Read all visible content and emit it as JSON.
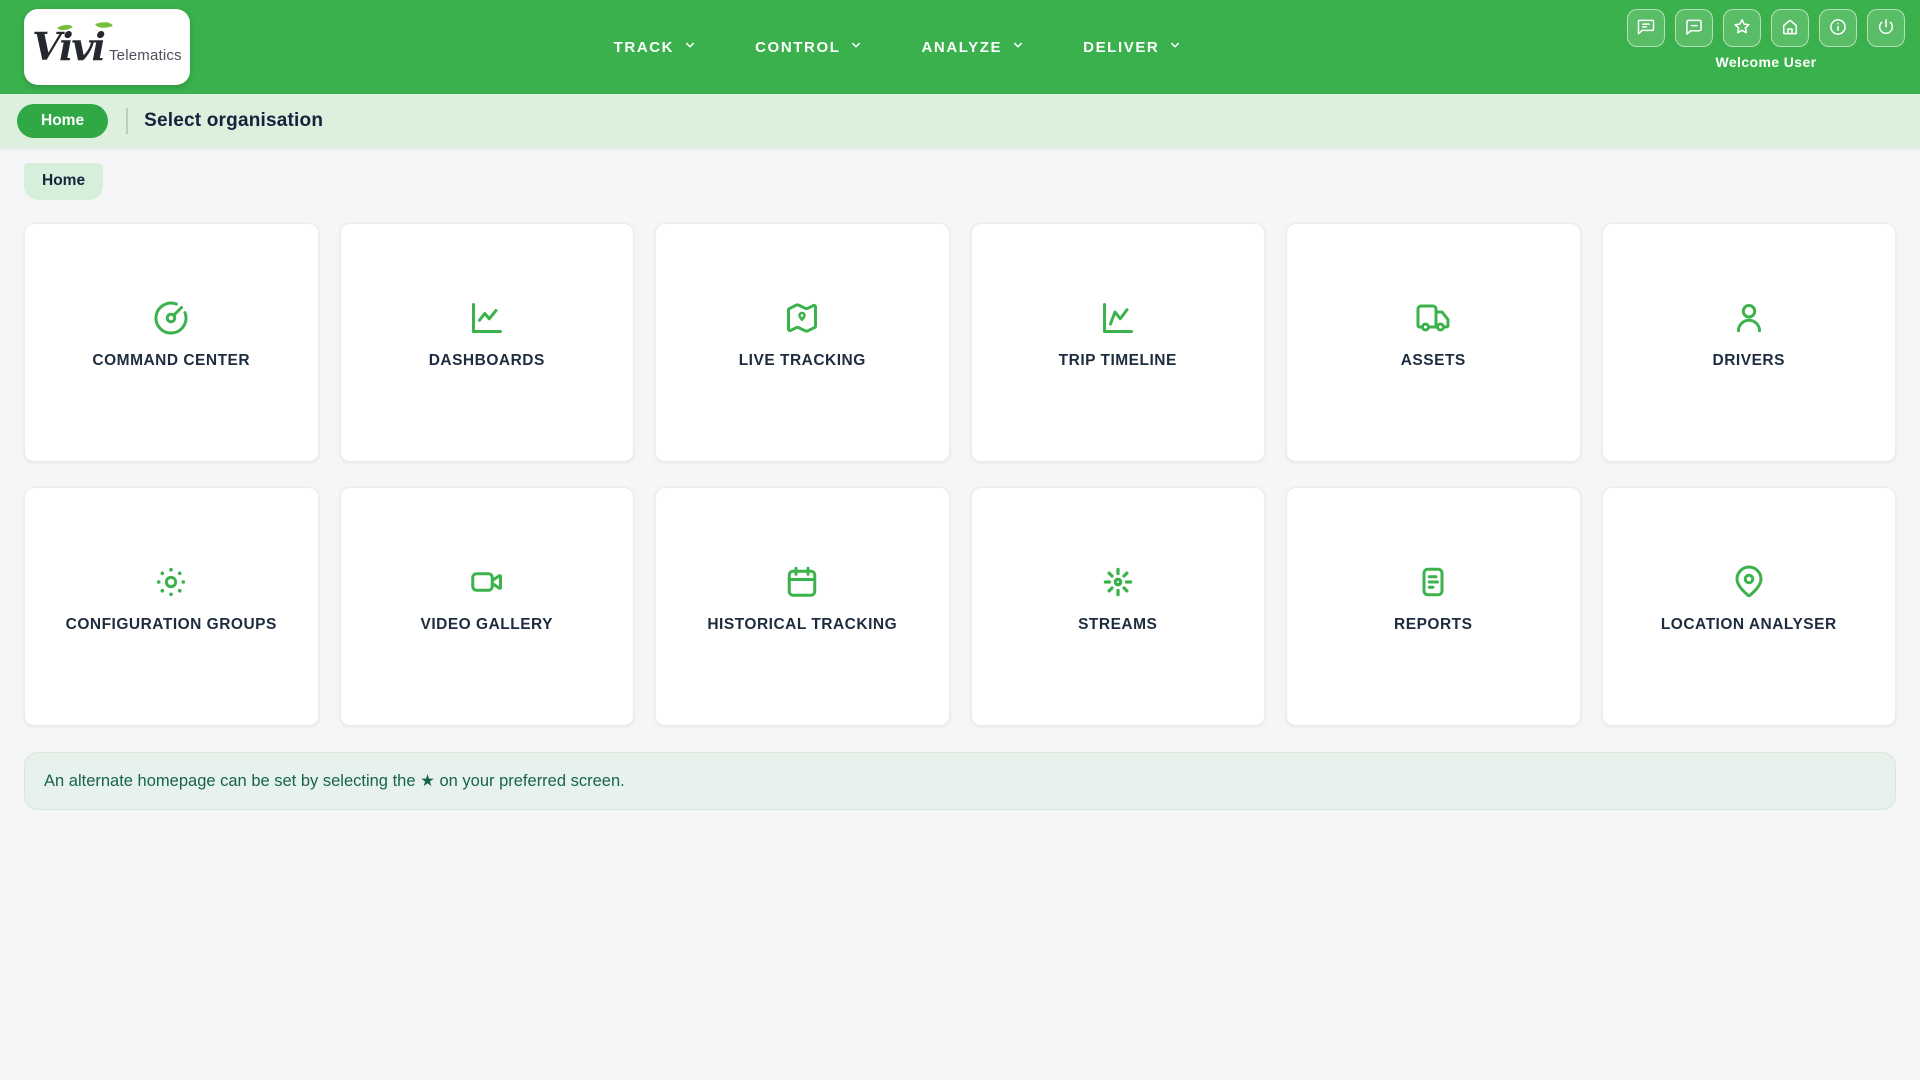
{
  "header": {
    "logo": {
      "brand": "Vivi",
      "suffix": "Telematics"
    },
    "nav_items": [
      {
        "label": "TRACK"
      },
      {
        "label": "CONTROL"
      },
      {
        "label": "ANALYZE"
      },
      {
        "label": "DELIVER"
      }
    ],
    "icon_buttons": [
      {
        "name": "feedback-icon"
      },
      {
        "name": "chat-icon"
      },
      {
        "name": "star-icon"
      },
      {
        "name": "home-icon"
      },
      {
        "name": "info-icon"
      },
      {
        "name": "power-icon"
      }
    ],
    "welcome_text": "Welcome User"
  },
  "subheader": {
    "active_page": "Home",
    "title": "Select organisation"
  },
  "tabs": [
    {
      "label": "Home"
    }
  ],
  "cards": [
    {
      "label": "COMMAND CENTER",
      "icon": "gauge-icon"
    },
    {
      "label": "DASHBOARDS",
      "icon": "line-chart-icon"
    },
    {
      "label": "LIVE TRACKING",
      "icon": "map-with-pin-icon"
    },
    {
      "label": "TRIP TIMELINE",
      "icon": "trend-chart-icon"
    },
    {
      "label": "ASSETS",
      "icon": "truck-icon"
    },
    {
      "label": "DRIVERS",
      "icon": "user-icon"
    },
    {
      "label": "CONFIGURATION GROUPS",
      "icon": "dotted-ring-icon"
    },
    {
      "label": "VIDEO GALLERY",
      "icon": "video-camera-icon"
    },
    {
      "label": "HISTORICAL TRACKING",
      "icon": "calendar-icon"
    },
    {
      "label": "STREAMS",
      "icon": "radiating-dot-icon"
    },
    {
      "label": "REPORTS",
      "icon": "report-document-icon"
    },
    {
      "label": "LOCATION ANALYSER",
      "icon": "map-pin-icon"
    }
  ],
  "note": {
    "text": "An alternate homepage can be set by selecting the ★ on your preferred screen."
  },
  "colors": {
    "header_green": "#3ab14c",
    "pill_green": "#2fa845",
    "subheader_bg": "#ddefdd",
    "tab_bg": "#d7eeda",
    "icon_green": "#3cb24c",
    "card_text": "#1d2c3e",
    "note_bg": "#e7f2ec",
    "note_text": "#176350",
    "page_bg": "#f4f6f7"
  }
}
